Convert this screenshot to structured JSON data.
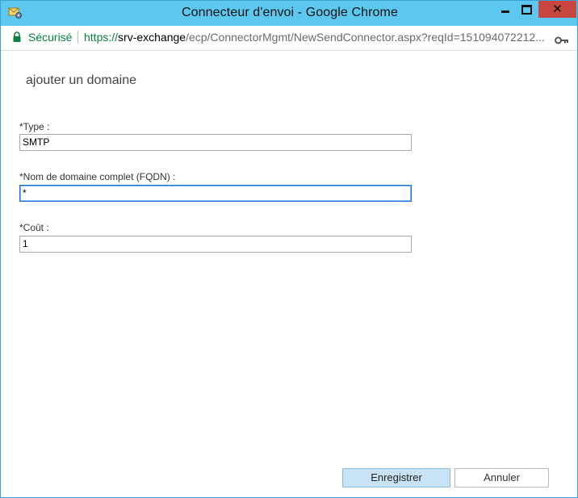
{
  "window": {
    "title": "Connecteur d'envoi - Google Chrome",
    "controls": {
      "minimize": "minimize",
      "maximize": "maximize",
      "close": "✕"
    }
  },
  "address_bar": {
    "security_label": "Sécurisé",
    "url_scheme": "https://",
    "url_host": "srv-exchange",
    "url_path": "/ecp/ConnectorMgmt/NewSendConnector.aspx?reqId=151094072212..."
  },
  "page": {
    "title": "ajouter un domaine",
    "fields": [
      {
        "label": "*Type :",
        "value": "SMTP"
      },
      {
        "label": "*Nom de domaine complet (FQDN) :",
        "value": "*"
      },
      {
        "label": "*Coût :",
        "value": "1"
      }
    ]
  },
  "footer": {
    "save_label": "Enregistrer",
    "cancel_label": "Annuler"
  },
  "colors": {
    "titlebar": "#5cc8ef",
    "secure_green": "#0b8043",
    "close_red": "#c7463d",
    "focus_blue": "#1c73d9",
    "save_button": "#c8e3f5"
  },
  "icons": [
    "exchange-app-icon",
    "lock-icon",
    "key-icon",
    "minimize-icon",
    "maximize-icon",
    "close-icon"
  ]
}
